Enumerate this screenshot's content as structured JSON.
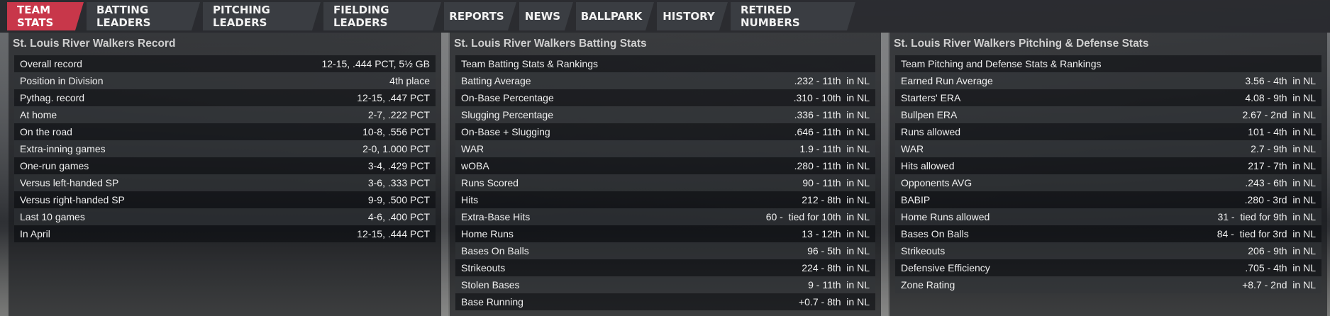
{
  "tabs": [
    {
      "label": "TEAM STATS",
      "active": true
    },
    {
      "label": "BATTING LEADERS",
      "active": false
    },
    {
      "label": "PITCHING LEADERS",
      "active": false
    },
    {
      "label": "FIELDING LEADERS",
      "active": false
    },
    {
      "label": "REPORTS",
      "active": false
    },
    {
      "label": "NEWS",
      "active": false
    },
    {
      "label": "BALLPARK",
      "active": false
    },
    {
      "label": "HISTORY",
      "active": false
    },
    {
      "label": "RETIRED NUMBERS",
      "active": false
    }
  ],
  "record": {
    "title": "St. Louis River Walkers Record",
    "rows": [
      {
        "label": "Overall record",
        "value": "12-15, .444 PCT, 5½ GB"
      },
      {
        "label": "Position in Division",
        "value": "4th place"
      },
      {
        "label": "Pythag. record",
        "value": "12-15, .447 PCT"
      },
      {
        "label": "At home",
        "value": "2-7, .222 PCT"
      },
      {
        "label": "On the road",
        "value": "10-8, .556 PCT"
      },
      {
        "label": "Extra-inning games",
        "value": "2-0, 1.000 PCT"
      },
      {
        "label": "One-run games",
        "value": "3-4, .429 PCT"
      },
      {
        "label": "Versus left-handed SP",
        "value": "3-6, .333 PCT"
      },
      {
        "label": "Versus right-handed SP",
        "value": "9-9, .500 PCT"
      },
      {
        "label": "Last 10 games",
        "value": "4-6, .400 PCT"
      },
      {
        "label": "In April",
        "value": "12-15, .444 PCT"
      }
    ]
  },
  "batting": {
    "title": "St. Louis River Walkers Batting Stats",
    "rows": [
      {
        "label": "Team Batting Stats & Rankings",
        "value": ""
      },
      {
        "label": "Batting Average",
        "value": ".232 - 11th  in NL"
      },
      {
        "label": "On-Base Percentage",
        "value": ".310 - 10th  in NL"
      },
      {
        "label": "Slugging Percentage",
        "value": ".336 - 11th  in NL"
      },
      {
        "label": "On-Base + Slugging",
        "value": ".646 - 11th  in NL"
      },
      {
        "label": "WAR",
        "value": "1.9 - 11th  in NL"
      },
      {
        "label": "wOBA",
        "value": ".280 - 11th  in NL"
      },
      {
        "label": "Runs Scored",
        "value": "90 - 11th  in NL"
      },
      {
        "label": "Hits",
        "value": "212 - 8th  in NL"
      },
      {
        "label": "Extra-Base Hits",
        "value": "60 -  tied for 10th  in NL"
      },
      {
        "label": "Home Runs",
        "value": "13 - 12th  in NL"
      },
      {
        "label": "Bases On Balls",
        "value": "96 - 5th  in NL"
      },
      {
        "label": "Strikeouts",
        "value": "224 - 8th  in NL"
      },
      {
        "label": "Stolen Bases",
        "value": "9 - 11th  in NL"
      },
      {
        "label": "Base Running",
        "value": "+0.7 - 8th  in NL"
      }
    ]
  },
  "pitching": {
    "title": "St. Louis River Walkers Pitching & Defense Stats",
    "rows": [
      {
        "label": "Team Pitching and Defense Stats & Rankings",
        "value": ""
      },
      {
        "label": "Earned Run Average",
        "value": "3.56 - 4th  in NL"
      },
      {
        "label": "Starters' ERA",
        "value": "4.08 - 9th  in NL"
      },
      {
        "label": "Bullpen ERA",
        "value": "2.67 - 2nd  in NL"
      },
      {
        "label": "Runs allowed",
        "value": "101 - 4th  in NL"
      },
      {
        "label": "WAR",
        "value": "2.7 - 9th  in NL"
      },
      {
        "label": "Hits allowed",
        "value": "217 - 7th  in NL"
      },
      {
        "label": "Opponents AVG",
        "value": ".243 - 6th  in NL"
      },
      {
        "label": "BABIP",
        "value": ".280 - 3rd  in NL"
      },
      {
        "label": "Home Runs allowed",
        "value": "31 -  tied for 9th  in NL"
      },
      {
        "label": "Bases On Balls",
        "value": "84 -  tied for 3rd  in NL"
      },
      {
        "label": "Strikeouts",
        "value": "206 - 9th  in NL"
      },
      {
        "label": "Defensive Efficiency",
        "value": ".705 - 4th  in NL"
      },
      {
        "label": "Zone Rating",
        "value": "+8.7 - 2nd  in NL"
      }
    ]
  }
}
